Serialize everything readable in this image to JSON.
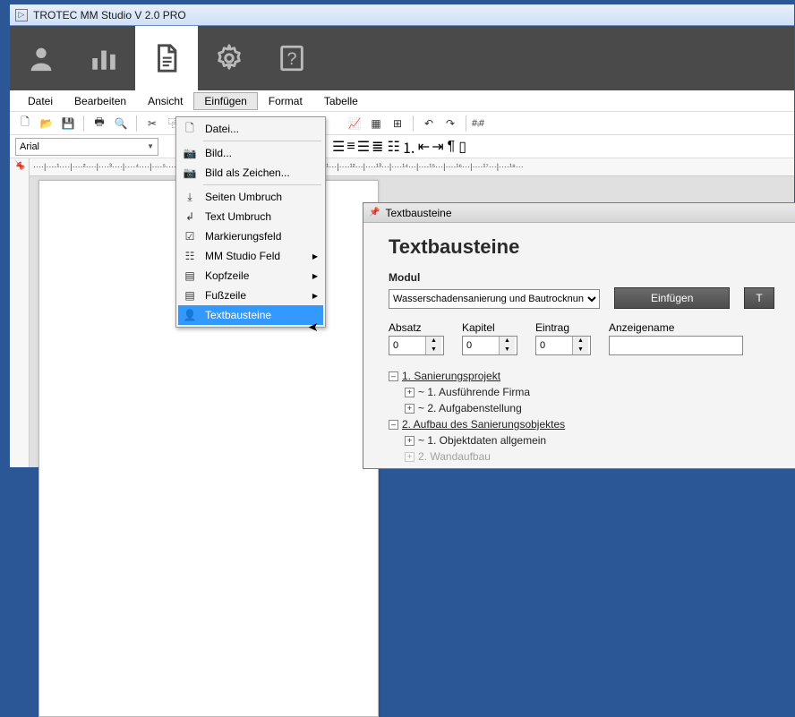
{
  "app": {
    "title": "TROTEC MM Studio V 2.0 PRO"
  },
  "menu": {
    "items": [
      "Datei",
      "Bearbeiten",
      "Ansicht",
      "Einfügen",
      "Format",
      "Tabelle"
    ],
    "open_index": 3,
    "dropdown": [
      {
        "label": "Datei...",
        "icon": "file-plus-icon"
      },
      {
        "sep": true
      },
      {
        "label": "Bild...",
        "icon": "camera-icon"
      },
      {
        "label": "Bild als Zeichen...",
        "icon": "camera-icon"
      },
      {
        "sep": true
      },
      {
        "label": "Seiten Umbruch",
        "icon": "page-break-icon"
      },
      {
        "label": "Text Umbruch",
        "icon": "text-break-icon"
      },
      {
        "label": "Markierungsfeld",
        "icon": "checkbox-icon"
      },
      {
        "label": "MM Studio Feld",
        "icon": "field-icon",
        "sub": true
      },
      {
        "label": "Kopfzeile",
        "icon": "header-icon",
        "sub": true
      },
      {
        "label": "Fußzeile",
        "icon": "footer-icon",
        "sub": true
      },
      {
        "label": "Textbausteine",
        "icon": "person-icon",
        "hl": true
      }
    ]
  },
  "toolbar": {
    "font": "Arial",
    "hash": "#ᵢ#"
  },
  "ruler": "····|····¹····|····²····|····³····|····⁴····|····⁵····|····⁶····|····⁷····|····⁸····|····⁹····|····¹⁰···|····¹¹···|····¹²···|····¹³···|····¹⁴···|····¹⁵···|····¹⁶···|····¹⁷···|····¹⁸···",
  "panel": {
    "title": "Textbausteine",
    "heading": "Textbausteine",
    "modul_label": "Modul",
    "modul_value": "Wasserschadensanierung und Bautrocknun",
    "insert_btn": "Einfügen",
    "second_btn": "T",
    "fields": {
      "absatz": {
        "label": "Absatz",
        "value": "0"
      },
      "kapitel": {
        "label": "Kapitel",
        "value": "0"
      },
      "eintrag": {
        "label": "Eintrag",
        "value": "0"
      },
      "anzeigename": {
        "label": "Anzeigename",
        "value": ""
      }
    },
    "tree": [
      {
        "level": 1,
        "exp": "-",
        "text": "1. Sanierungsprojekt",
        "u": true
      },
      {
        "level": 2,
        "exp": "+",
        "text": "~ 1. Ausführende Firma"
      },
      {
        "level": 2,
        "exp": "+",
        "text": "~ 2. Aufgabenstellung"
      },
      {
        "level": 1,
        "exp": "-",
        "text": "2. Aufbau des Sanierungsobjektes",
        "u": true
      },
      {
        "level": 2,
        "exp": "+",
        "text": "~ 1. Objektdaten allgemein"
      },
      {
        "level": 2,
        "exp": "+",
        "text": "   2. Wandaufbau",
        "cut": true
      }
    ]
  }
}
